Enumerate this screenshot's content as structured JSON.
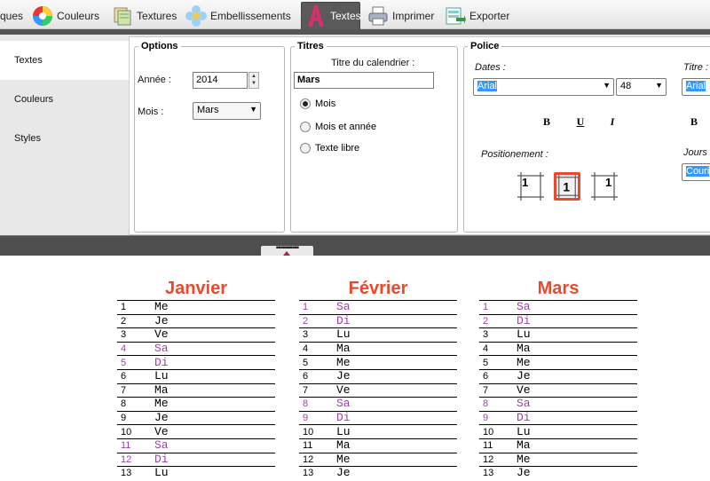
{
  "toolbar": {
    "items": [
      {
        "label": "ques",
        "icon": "calendar-icon"
      },
      {
        "label": "Couleurs",
        "icon": "color-wheel-icon"
      },
      {
        "label": "Textures",
        "icon": "texture-icon"
      },
      {
        "label": "Embellissements",
        "icon": "flower-icon"
      },
      {
        "label": "Textes",
        "icon": "letter-a-icon",
        "active": true
      },
      {
        "label": "Imprimer",
        "icon": "printer-icon"
      },
      {
        "label": "Exporter",
        "icon": "export-icon"
      }
    ]
  },
  "sidebar": {
    "tabs": [
      "Textes",
      "Couleurs",
      "Styles"
    ],
    "active": "Textes"
  },
  "options": {
    "legend": "Options",
    "year_label": "Année :",
    "year_value": "2014",
    "month_label": "Mois :",
    "month_value": "Mars"
  },
  "titres": {
    "legend": "Titres",
    "calendar_title_label": "Titre du calendrier :",
    "calendar_title_value": "Mars",
    "radio_options": [
      "Mois",
      "Mois et année",
      "Texte libre"
    ],
    "selected": "Mois"
  },
  "police": {
    "legend": "Police",
    "dates_label": "Dates :",
    "dates_font": "Arial",
    "dates_size": "48",
    "bold": "B",
    "underline": "U",
    "italic": "I",
    "positioning_label": "Positionement :",
    "position_sample": "1",
    "title_label": "Titre :",
    "title_font": "Arial",
    "title_bold": "B",
    "days_label": "Jours",
    "days_font": "Couri"
  },
  "colors": {
    "accent": "#e84a2e",
    "weekend": "#a040a8",
    "highlight": "#3399ff",
    "position_selected": "#e84a2e"
  },
  "calendar": {
    "months": [
      {
        "name": "Janvier",
        "days": [
          {
            "n": "1",
            "d": "Me",
            "we": false
          },
          {
            "n": "2",
            "d": "Je",
            "we": false
          },
          {
            "n": "3",
            "d": "Ve",
            "we": false
          },
          {
            "n": "4",
            "d": "Sa",
            "we": true
          },
          {
            "n": "5",
            "d": "Di",
            "we": true
          },
          {
            "n": "6",
            "d": "Lu",
            "we": false
          },
          {
            "n": "7",
            "d": "Ma",
            "we": false
          },
          {
            "n": "8",
            "d": "Me",
            "we": false
          },
          {
            "n": "9",
            "d": "Je",
            "we": false
          },
          {
            "n": "10",
            "d": "Ve",
            "we": false
          },
          {
            "n": "11",
            "d": "Sa",
            "we": true
          },
          {
            "n": "12",
            "d": "Di",
            "we": true
          },
          {
            "n": "13",
            "d": "Lu",
            "we": false
          }
        ]
      },
      {
        "name": "Février",
        "days": [
          {
            "n": "1",
            "d": "Sa",
            "we": true
          },
          {
            "n": "2",
            "d": "Di",
            "we": true
          },
          {
            "n": "3",
            "d": "Lu",
            "we": false
          },
          {
            "n": "4",
            "d": "Ma",
            "we": false
          },
          {
            "n": "5",
            "d": "Me",
            "we": false
          },
          {
            "n": "6",
            "d": "Je",
            "we": false
          },
          {
            "n": "7",
            "d": "Ve",
            "we": false
          },
          {
            "n": "8",
            "d": "Sa",
            "we": true
          },
          {
            "n": "9",
            "d": "Di",
            "we": true
          },
          {
            "n": "10",
            "d": "Lu",
            "we": false
          },
          {
            "n": "11",
            "d": "Ma",
            "we": false
          },
          {
            "n": "12",
            "d": "Me",
            "we": false
          },
          {
            "n": "13",
            "d": "Je",
            "we": false
          }
        ]
      },
      {
        "name": "Mars",
        "days": [
          {
            "n": "1",
            "d": "Sa",
            "we": true
          },
          {
            "n": "2",
            "d": "Di",
            "we": true
          },
          {
            "n": "3",
            "d": "Lu",
            "we": false
          },
          {
            "n": "4",
            "d": "Ma",
            "we": false
          },
          {
            "n": "5",
            "d": "Me",
            "we": false
          },
          {
            "n": "6",
            "d": "Je",
            "we": false
          },
          {
            "n": "7",
            "d": "Ve",
            "we": false
          },
          {
            "n": "8",
            "d": "Sa",
            "we": true
          },
          {
            "n": "9",
            "d": "Di",
            "we": true
          },
          {
            "n": "10",
            "d": "Lu",
            "we": false
          },
          {
            "n": "11",
            "d": "Ma",
            "we": false
          },
          {
            "n": "12",
            "d": "Me",
            "we": false
          },
          {
            "n": "13",
            "d": "Je",
            "we": false
          }
        ]
      }
    ]
  }
}
